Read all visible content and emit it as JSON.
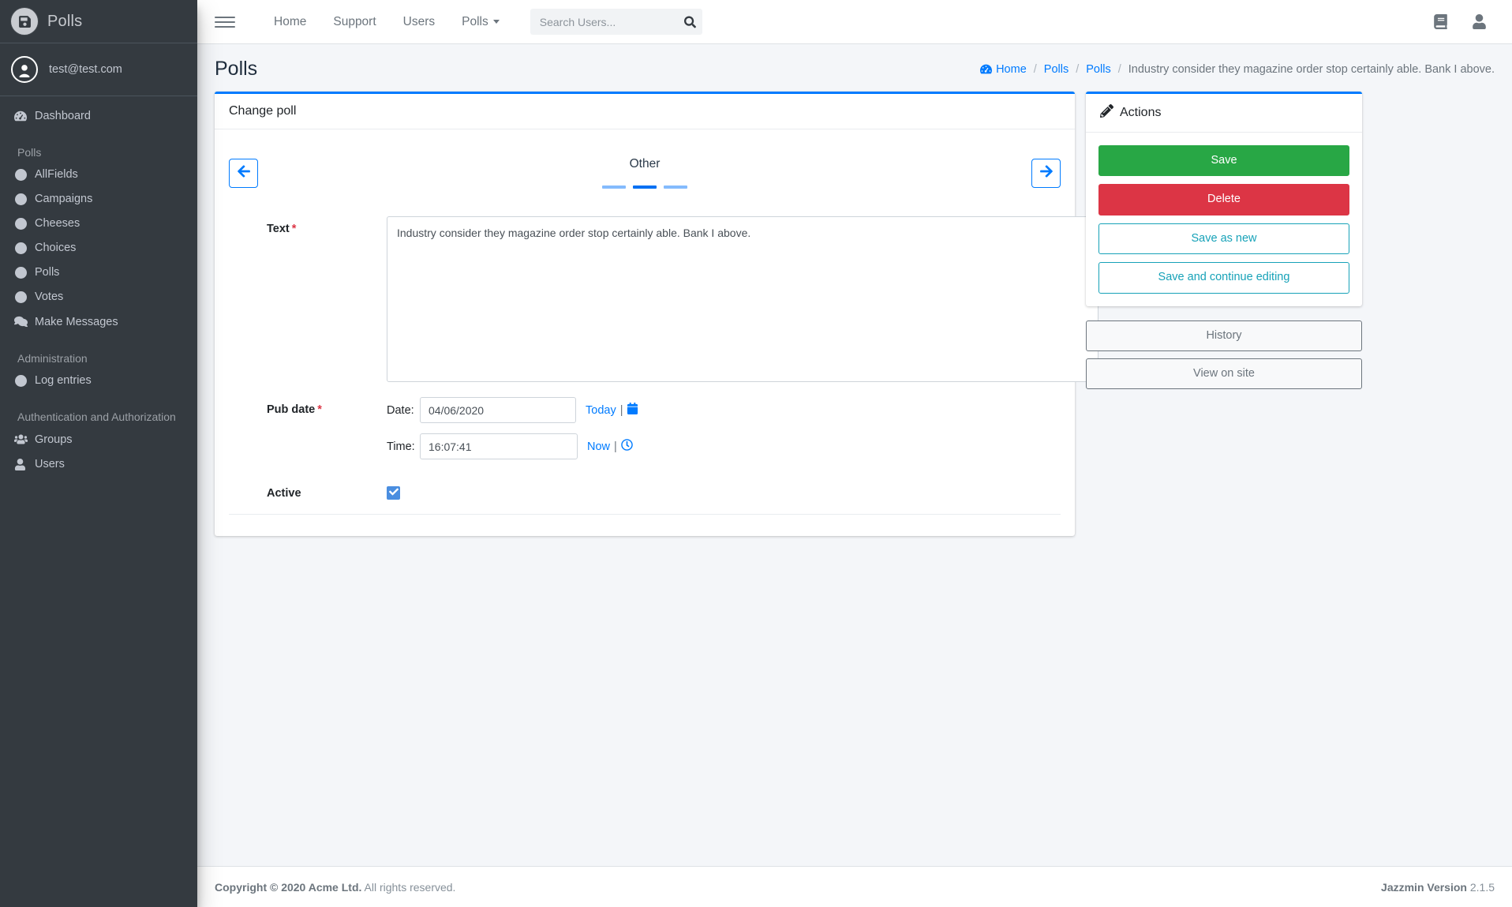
{
  "sidebar": {
    "brand": {
      "title": "Polls",
      "logo_icon": "save-badge-icon"
    },
    "user": {
      "name": "test@test.com",
      "avatar_icon": "user-circle-icon"
    },
    "dashboard": {
      "label": "Dashboard",
      "icon": "tachometer-icon"
    },
    "sections": [
      {
        "header": "Polls",
        "items": [
          {
            "label": "AllFields",
            "icon": "circle-icon"
          },
          {
            "label": "Campaigns",
            "icon": "circle-icon"
          },
          {
            "label": "Cheeses",
            "icon": "circle-icon"
          },
          {
            "label": "Choices",
            "icon": "circle-icon"
          },
          {
            "label": "Polls",
            "icon": "circle-icon"
          },
          {
            "label": "Votes",
            "icon": "circle-icon"
          },
          {
            "label": "Make Messages",
            "icon": "comments-icon"
          }
        ]
      },
      {
        "header": "Administration",
        "items": [
          {
            "label": "Log entries",
            "icon": "circle-icon"
          }
        ]
      },
      {
        "header": "Authentication and Authorization",
        "items": [
          {
            "label": "Groups",
            "icon": "users-icon"
          },
          {
            "label": "Users",
            "icon": "user-icon"
          }
        ]
      }
    ]
  },
  "navbar": {
    "hamburger_icon": "bars-icon",
    "links": [
      {
        "label": "Home",
        "has_caret": false
      },
      {
        "label": "Support",
        "has_caret": false
      },
      {
        "label": "Users",
        "has_caret": false
      },
      {
        "label": "Polls",
        "has_caret": true
      }
    ],
    "search": {
      "placeholder": "Search Users...",
      "value": "",
      "icon": "search-icon"
    },
    "right_icons": [
      {
        "name": "book-icon"
      },
      {
        "name": "user-icon"
      }
    ]
  },
  "header": {
    "page_title": "Polls",
    "breadcrumb": {
      "home": "Home",
      "home_icon": "tachometer-icon",
      "links": [
        "Polls",
        "Polls"
      ],
      "active": "Industry consider they magazine order stop certainly able. Bank I above.",
      "separator": "/"
    }
  },
  "form_card": {
    "title": "Change poll",
    "carousel": {
      "prev_icon": "arrow-left-icon",
      "next_icon": "arrow-right-icon",
      "tab_title": "Other",
      "indicator_count": 3,
      "active_index": 1
    },
    "fields": {
      "text": {
        "label": "Text",
        "required_marker": "*",
        "value": "Industry consider they magazine order stop certainly able. Bank I above."
      },
      "pub_date": {
        "label": "Pub date",
        "required_marker": "*",
        "date_label": "Date:",
        "date_value": "04/06/2020",
        "date_shortcut": "Today",
        "date_separator": "|",
        "date_icon": "calendar-icon",
        "time_label": "Time:",
        "time_value": "16:07:41",
        "time_shortcut": "Now",
        "time_separator": "|",
        "time_icon": "clock-icon"
      },
      "active": {
        "label": "Active",
        "checked": true,
        "check_icon": "check-icon"
      }
    }
  },
  "actions_card": {
    "title": "Actions",
    "icon": "edit-square-icon",
    "buttons": [
      {
        "label": "Save",
        "style": "success"
      },
      {
        "label": "Delete",
        "style": "danger"
      },
      {
        "label": "Save as new",
        "style": "outline-info"
      },
      {
        "label": "Save and continue editing",
        "style": "outline-info"
      }
    ],
    "extra_buttons": [
      {
        "label": "History",
        "style": "outline-secondary"
      },
      {
        "label": "View on site",
        "style": "outline-secondary"
      }
    ]
  },
  "footer": {
    "copyright_bold": "Copyright © 2020 Acme Ltd.",
    "copyright_rest": "All rights reserved.",
    "version_bold": "Jazzmin Version",
    "version_number": "2.1.5"
  },
  "colors": {
    "sidebar_bg": "#343a40",
    "accent": "#007bff",
    "success": "#28a745",
    "danger": "#dc3545",
    "info": "#17a2b8",
    "required": "#dc3545"
  }
}
